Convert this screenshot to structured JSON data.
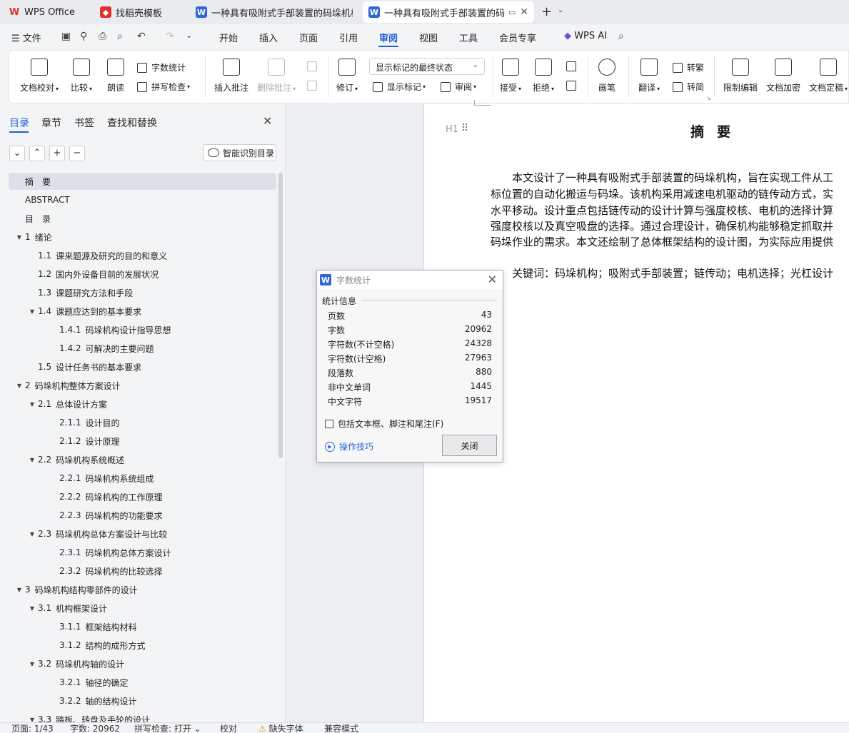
{
  "tabs": [
    {
      "label": "WPS Office",
      "icon": "wps-logo-icon",
      "color": "#e0302e"
    },
    {
      "label": "找稻壳模板",
      "icon": "docer-icon",
      "color": "#e0302e"
    },
    {
      "label": "一种具有吸附式手部装置的码垛机构设",
      "icon": "word-doc-icon",
      "color": "#2f65d8"
    },
    {
      "label": "一种具有吸附式手部装置的码垛",
      "icon": "word-doc-icon",
      "color": "#2f65d8"
    }
  ],
  "menubar": {
    "file": "文件",
    "items": [
      "开始",
      "插入",
      "页面",
      "引用",
      "审阅",
      "视图",
      "工具",
      "会员专享"
    ],
    "active": "审阅",
    "ai": "WPS AI"
  },
  "ribbon": {
    "doc_proof": "文档校对",
    "compare": "比较",
    "read_aloud": "朗读",
    "word_count": "字数统计",
    "spell_check": "拼写检查",
    "insert_comment": "插入批注",
    "delete_comment": "删除批注",
    "track_changes": "修订",
    "markup_state": "显示标记的最终状态",
    "show_markup": "显示标记",
    "review_pane": "审阅",
    "accept": "接受",
    "reject": "拒绝",
    "pen": "画笔",
    "translate": "翻译",
    "to_traditional": "转繁",
    "to_simplified": "转简",
    "restrict_edit": "限制编辑",
    "encrypt": "文档加密",
    "finalize": "文档定稿"
  },
  "nav": {
    "tabs": [
      "目录",
      "章节",
      "书签",
      "查找和替换"
    ],
    "smart_toc": "智能识别目录",
    "toc": [
      {
        "num": "",
        "text": "摘　要",
        "level": 0,
        "arrow": false,
        "selected": true
      },
      {
        "num": "",
        "text": "ABSTRACT",
        "level": 0,
        "arrow": false
      },
      {
        "num": "",
        "text": "目　录",
        "level": 0,
        "arrow": false
      },
      {
        "num": "1",
        "text": "绪论",
        "level": 0,
        "arrow": true
      },
      {
        "num": "1.1",
        "text": "课来题源及研究的目的和意义",
        "level": 1,
        "arrow": false
      },
      {
        "num": "1.2",
        "text": "国内外设备目前的发展状况",
        "level": 1,
        "arrow": false
      },
      {
        "num": "1.3",
        "text": "课题研究方法和手段",
        "level": 1,
        "arrow": false
      },
      {
        "num": "1.4",
        "text": "课题应达到的基本要求",
        "level": 1,
        "arrow": true
      },
      {
        "num": "1.4.1",
        "text": "码垛机构设计指导思想",
        "level": 2,
        "arrow": false
      },
      {
        "num": "1.4.2",
        "text": "可解决的主要问题",
        "level": 2,
        "arrow": false
      },
      {
        "num": "1.5",
        "text": "设计任务书的基本要求",
        "level": 1,
        "arrow": false
      },
      {
        "num": "2",
        "text": "码垛机构整体方案设计",
        "level": 0,
        "arrow": true
      },
      {
        "num": "2.1",
        "text": "总体设计方案",
        "level": 1,
        "arrow": true
      },
      {
        "num": "2.1.1",
        "text": "设计目的",
        "level": 2,
        "arrow": false
      },
      {
        "num": "2.1.2",
        "text": "设计原理",
        "level": 2,
        "arrow": false
      },
      {
        "num": "2.2",
        "text": "码垛机构系统概述",
        "level": 1,
        "arrow": true
      },
      {
        "num": "2.2.1",
        "text": "码垛机构系统组成",
        "level": 2,
        "arrow": false
      },
      {
        "num": "2.2.2",
        "text": "码垛机构的工作原理",
        "level": 2,
        "arrow": false
      },
      {
        "num": "2.2.3",
        "text": "码垛机构的功能要求",
        "level": 2,
        "arrow": false
      },
      {
        "num": "2.3",
        "text": "码垛机构总体方案设计与比较",
        "level": 1,
        "arrow": true
      },
      {
        "num": "2.3.1",
        "text": "码垛机构总体方案设计",
        "level": 2,
        "arrow": false
      },
      {
        "num": "2.3.2",
        "text": "码垛机构的比较选择",
        "level": 2,
        "arrow": false
      },
      {
        "num": "3",
        "text": "码垛机构结构零部件的设计",
        "level": 0,
        "arrow": true
      },
      {
        "num": "3.1",
        "text": "机构框架设计",
        "level": 1,
        "arrow": true
      },
      {
        "num": "3.1.1",
        "text": "框架结构材料",
        "level": 2,
        "arrow": false
      },
      {
        "num": "3.1.2",
        "text": "结构的成形方式",
        "level": 2,
        "arrow": false
      },
      {
        "num": "3.2",
        "text": "码垛机构轴的设计",
        "level": 1,
        "arrow": true
      },
      {
        "num": "3.2.1",
        "text": "轴径的确定",
        "level": 2,
        "arrow": false
      },
      {
        "num": "3.2.2",
        "text": "轴的结构设计",
        "level": 2,
        "arrow": false
      },
      {
        "num": "3.3",
        "text": "踏板、转盘及手轮的设计",
        "level": 1,
        "arrow": true
      }
    ]
  },
  "document": {
    "heading_tag": "H1",
    "title": "摘要",
    "lines": [
      "　　本文设计了一种具有吸附式手部装置的码垛机构，旨在实现工件从工",
      "标位置的自动化搬运与码垛。该机构采用减速电机驱动的链传动方式，实",
      "水平移动。设计重点包括链传动的设计计算与强度校核、电机的选择计算",
      "强度校核以及真空吸盘的选择。通过合理设计，确保机构能够稳定抓取并",
      "码垛作业的需求。本文还绘制了总体框架结构的设计图，为实际应用提供"
    ],
    "keywords": "　　关键词：码垛机构；吸附式手部装置；链传动；电机选择；光杠设计"
  },
  "dialog": {
    "title": "字数统计",
    "group": "统计信息",
    "stats": [
      {
        "label": "页数",
        "value": "43"
      },
      {
        "label": "字数",
        "value": "20962"
      },
      {
        "label": "字符数(不计空格)",
        "value": "24328"
      },
      {
        "label": "字符数(计空格)",
        "value": "27963"
      },
      {
        "label": "段落数",
        "value": "880"
      },
      {
        "label": "非中文单词",
        "value": "1445"
      },
      {
        "label": "中文字符",
        "value": "19517"
      }
    ],
    "checkbox_label": "包括文本框、脚注和尾注(F)",
    "checkbox_checked": false,
    "tips": "操作技巧",
    "close_label": "关闭"
  },
  "statusbar": {
    "page": "页面: 1/43",
    "words": "字数: 20962",
    "spell": "拼写检查: 打开",
    "proof": "校对",
    "missing_font": "缺失字体",
    "compat": "兼容模式"
  }
}
